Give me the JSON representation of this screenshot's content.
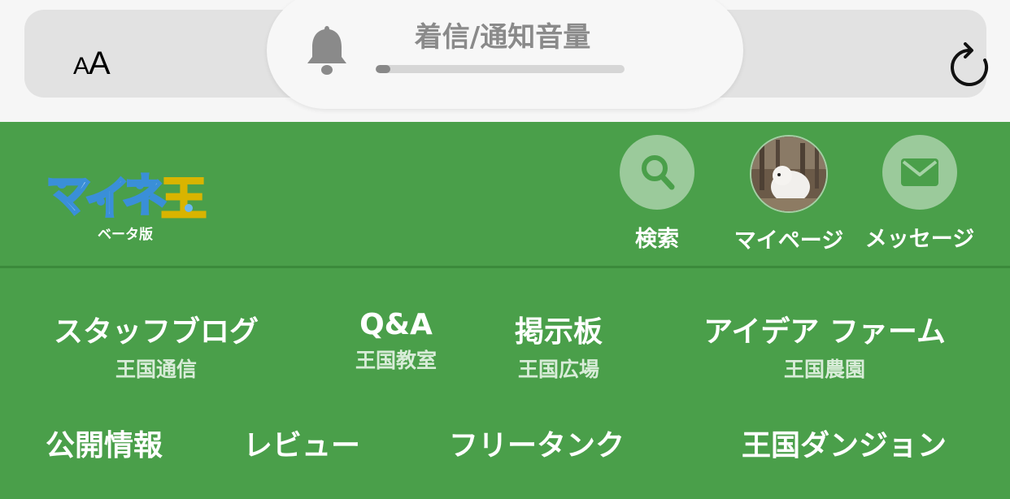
{
  "browser": {
    "text_size_label": "AA",
    "reload_icon": "reload-icon"
  },
  "volume_hud": {
    "title": "着信/通知音量",
    "icon": "bell-icon",
    "level": 0.06
  },
  "header": {
    "logo_text": "マイネ王",
    "logo_sub": "ベータ版",
    "buttons": [
      {
        "label": "検索",
        "icon": "search-icon"
      },
      {
        "label": "マイページ",
        "icon": "avatar"
      },
      {
        "label": "メッセージ",
        "icon": "envelope-icon"
      }
    ]
  },
  "nav": {
    "row1": [
      {
        "label": "スタッフブログ",
        "sub": "王国通信"
      },
      {
        "label": "Q&A",
        "sub": "王国教室"
      },
      {
        "label": "掲示板",
        "sub": "王国広場"
      },
      {
        "label": "アイデア ファーム",
        "sub": "王国農園"
      }
    ],
    "row2": [
      {
        "label": "公開情報"
      },
      {
        "label": "レビュー"
      },
      {
        "label": "フリータンク"
      },
      {
        "label": "王国ダンジョン"
      }
    ]
  },
  "colors": {
    "header_green": "#4a9f4a",
    "browser_bg": "#f6f6f6"
  }
}
